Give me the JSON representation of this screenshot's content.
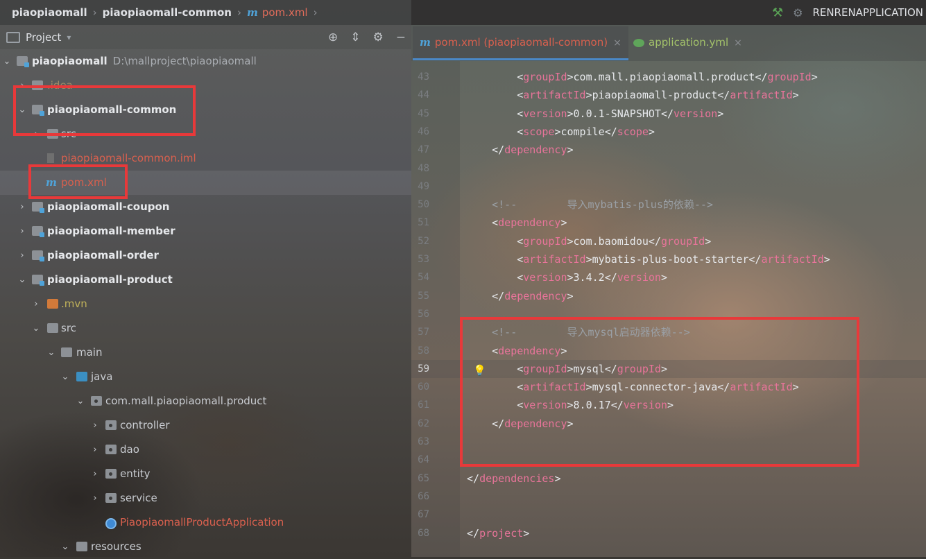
{
  "breadcrumb": {
    "items": [
      "piaopiaomall",
      "piaopiaomall-common",
      "pom.xml"
    ]
  },
  "run_config": "RENRENAPPLICATION",
  "project_panel": {
    "title": "Project",
    "tree": [
      {
        "label": "piaopiaomall",
        "path": "D:\\mallproject\\piaopiaomall"
      },
      {
        "label": ".idea"
      },
      {
        "label": "piaopiaomall-common"
      },
      {
        "label": "src"
      },
      {
        "label": "piaopiaomall-common.iml"
      },
      {
        "label": "pom.xml"
      },
      {
        "label": "piaopiaomall-coupon"
      },
      {
        "label": "piaopiaomall-member"
      },
      {
        "label": "piaopiaomall-order"
      },
      {
        "label": "piaopiaomall-product"
      },
      {
        "label": ".mvn"
      },
      {
        "label": "src"
      },
      {
        "label": "main"
      },
      {
        "label": "java"
      },
      {
        "label": "com.mall.piaopiaomall.product"
      },
      {
        "label": "controller"
      },
      {
        "label": "dao"
      },
      {
        "label": "entity"
      },
      {
        "label": "service"
      },
      {
        "label": "PiaopiaomallProductApplication"
      },
      {
        "label": "resources"
      }
    ]
  },
  "editor": {
    "tabs": [
      {
        "label": "pom.xml (piaopiaomall-common)",
        "close": "×"
      },
      {
        "label": "application.yml",
        "close": "×"
      }
    ],
    "lines": [
      {
        "n": "43",
        "indent": "        ",
        "parts": [
          [
            "br",
            "<"
          ],
          [
            "tg",
            "groupId"
          ],
          [
            "br",
            ">"
          ],
          [
            "tx",
            "com.mall.piaopiaomall.product"
          ],
          [
            "br",
            "</"
          ],
          [
            "tg",
            "groupId"
          ],
          [
            "br",
            ">"
          ]
        ]
      },
      {
        "n": "44",
        "indent": "        ",
        "parts": [
          [
            "br",
            "<"
          ],
          [
            "tg",
            "artifactId"
          ],
          [
            "br",
            ">"
          ],
          [
            "tx",
            "piaopiaomall-product"
          ],
          [
            "br",
            "</"
          ],
          [
            "tg",
            "artifactId"
          ],
          [
            "br",
            ">"
          ]
        ]
      },
      {
        "n": "45",
        "indent": "        ",
        "parts": [
          [
            "br",
            "<"
          ],
          [
            "tg",
            "version"
          ],
          [
            "br",
            ">"
          ],
          [
            "tx",
            "0.0.1-SNAPSHOT"
          ],
          [
            "br",
            "</"
          ],
          [
            "tg",
            "version"
          ],
          [
            "br",
            ">"
          ]
        ]
      },
      {
        "n": "46",
        "indent": "        ",
        "parts": [
          [
            "br",
            "<"
          ],
          [
            "tg",
            "scope"
          ],
          [
            "br",
            ">"
          ],
          [
            "tx",
            "compile"
          ],
          [
            "br",
            "</"
          ],
          [
            "tg",
            "scope"
          ],
          [
            "br",
            ">"
          ]
        ]
      },
      {
        "n": "47",
        "indent": "    ",
        "parts": [
          [
            "br",
            "</"
          ],
          [
            "tg",
            "dependency"
          ],
          [
            "br",
            ">"
          ]
        ]
      },
      {
        "n": "48",
        "indent": "",
        "parts": []
      },
      {
        "n": "49",
        "indent": "",
        "parts": []
      },
      {
        "n": "50",
        "indent": "    ",
        "parts": [
          [
            "cm",
            "<!--        导入mybatis-plus的依赖-->"
          ]
        ]
      },
      {
        "n": "51",
        "indent": "    ",
        "parts": [
          [
            "br",
            "<"
          ],
          [
            "tg",
            "dependency"
          ],
          [
            "br",
            ">"
          ]
        ]
      },
      {
        "n": "52",
        "indent": "        ",
        "parts": [
          [
            "br",
            "<"
          ],
          [
            "tg",
            "groupId"
          ],
          [
            "br",
            ">"
          ],
          [
            "tx",
            "com.baomidou"
          ],
          [
            "br",
            "</"
          ],
          [
            "tg",
            "groupId"
          ],
          [
            "br",
            ">"
          ]
        ]
      },
      {
        "n": "53",
        "indent": "        ",
        "parts": [
          [
            "br",
            "<"
          ],
          [
            "tg",
            "artifactId"
          ],
          [
            "br",
            ">"
          ],
          [
            "tx",
            "mybatis-plus-boot-starter"
          ],
          [
            "br",
            "</"
          ],
          [
            "tg",
            "artifactId"
          ],
          [
            "br",
            ">"
          ]
        ]
      },
      {
        "n": "54",
        "indent": "        ",
        "parts": [
          [
            "br",
            "<"
          ],
          [
            "tg",
            "version"
          ],
          [
            "br",
            ">"
          ],
          [
            "tx",
            "3.4.2"
          ],
          [
            "br",
            "</"
          ],
          [
            "tg",
            "version"
          ],
          [
            "br",
            ">"
          ]
        ]
      },
      {
        "n": "55",
        "indent": "    ",
        "parts": [
          [
            "br",
            "</"
          ],
          [
            "tg",
            "dependency"
          ],
          [
            "br",
            ">"
          ]
        ]
      },
      {
        "n": "56",
        "indent": "",
        "parts": []
      },
      {
        "n": "57",
        "indent": "    ",
        "parts": [
          [
            "cm",
            "<!--        导入mysql启动器依赖-->"
          ]
        ]
      },
      {
        "n": "58",
        "indent": "    ",
        "parts": [
          [
            "br",
            "<"
          ],
          [
            "tg",
            "dependency"
          ],
          [
            "br",
            ">"
          ]
        ]
      },
      {
        "n": "59",
        "indent": "        ",
        "parts": [
          [
            "br",
            "<"
          ],
          [
            "tg",
            "groupId"
          ],
          [
            "br",
            ">"
          ],
          [
            "tx",
            "mysql"
          ],
          [
            "br",
            "</"
          ],
          [
            "tg",
            "groupId"
          ],
          [
            "br",
            ">"
          ]
        ]
      },
      {
        "n": "60",
        "indent": "        ",
        "parts": [
          [
            "br",
            "<"
          ],
          [
            "tg",
            "artifactId"
          ],
          [
            "br",
            ">"
          ],
          [
            "tx",
            "mysql-connector-java"
          ],
          [
            "br",
            "</"
          ],
          [
            "tg",
            "artifactId"
          ],
          [
            "br",
            ">"
          ]
        ]
      },
      {
        "n": "61",
        "indent": "        ",
        "parts": [
          [
            "br",
            "<"
          ],
          [
            "tg",
            "version"
          ],
          [
            "br",
            ">"
          ],
          [
            "tx",
            "8.0.17"
          ],
          [
            "br",
            "</"
          ],
          [
            "tg",
            "version"
          ],
          [
            "br",
            ">"
          ]
        ]
      },
      {
        "n": "62",
        "indent": "    ",
        "parts": [
          [
            "br",
            "</"
          ],
          [
            "tg",
            "dependency"
          ],
          [
            "br",
            ">"
          ]
        ]
      },
      {
        "n": "63",
        "indent": "",
        "parts": []
      },
      {
        "n": "64",
        "indent": "",
        "parts": []
      },
      {
        "n": "65",
        "indent": "",
        "parts": [
          [
            "br",
            "</"
          ],
          [
            "tg",
            "dependencies"
          ],
          [
            "br",
            ">"
          ]
        ]
      },
      {
        "n": "66",
        "indent": "",
        "parts": []
      },
      {
        "n": "67",
        "indent": "",
        "parts": []
      },
      {
        "n": "68",
        "indent": "",
        "parts": [
          [
            "br",
            "</"
          ],
          [
            "tg",
            "project"
          ],
          [
            "br",
            ">"
          ]
        ]
      }
    ]
  },
  "colors": {
    "highlight_box": "#e8393a",
    "xml_tag": "#e8749a",
    "error_file": "#d9604e",
    "module_icon": "#4fa3d9"
  }
}
